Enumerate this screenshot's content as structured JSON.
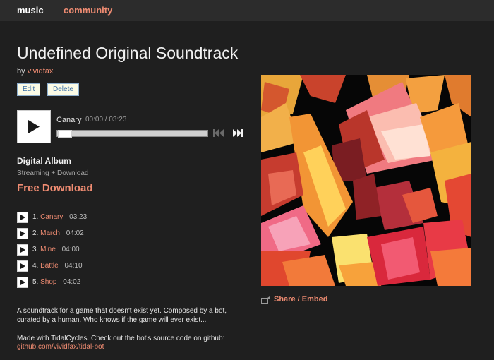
{
  "nav": {
    "music": "music",
    "community": "community"
  },
  "album": {
    "title": "Undefined Original Soundtrack",
    "by_prefix": "by",
    "artist": "vividfax"
  },
  "actions": {
    "edit": "Edit",
    "delete": "Delete"
  },
  "player": {
    "current_track": "Canary",
    "time": "00:00 / 03:23",
    "progress": 0,
    "icons": [
      "play-icon",
      "previous-track-icon",
      "next-track-icon"
    ]
  },
  "purchase": {
    "format": "Digital Album",
    "sub": "Streaming + Download",
    "free_download": "Free Download"
  },
  "tracks": [
    {
      "num": "1.",
      "name": "Canary",
      "duration": "03:23"
    },
    {
      "num": "2.",
      "name": "March",
      "duration": "04:02"
    },
    {
      "num": "3.",
      "name": "Mine",
      "duration": "04:00"
    },
    {
      "num": "4.",
      "name": "Battle",
      "duration": "04:10"
    },
    {
      "num": "5.",
      "name": "Shop",
      "duration": "04:02"
    }
  ],
  "description": {
    "line1": "A soundtrack for a game that doesn't exist yet. Composed by a bot, curated by a human. Who knows if the game will ever exist...",
    "line2": "Made with TidalCycles. Check out the bot's source code on github:",
    "link": "github.com/vividfax/tidal-bot"
  },
  "share": {
    "label": "Share / Embed",
    "icon": "share-icon"
  },
  "colors": {
    "accent": "#f08c72",
    "background": "#1f1f1f",
    "topbar": "#2c2c2c"
  }
}
